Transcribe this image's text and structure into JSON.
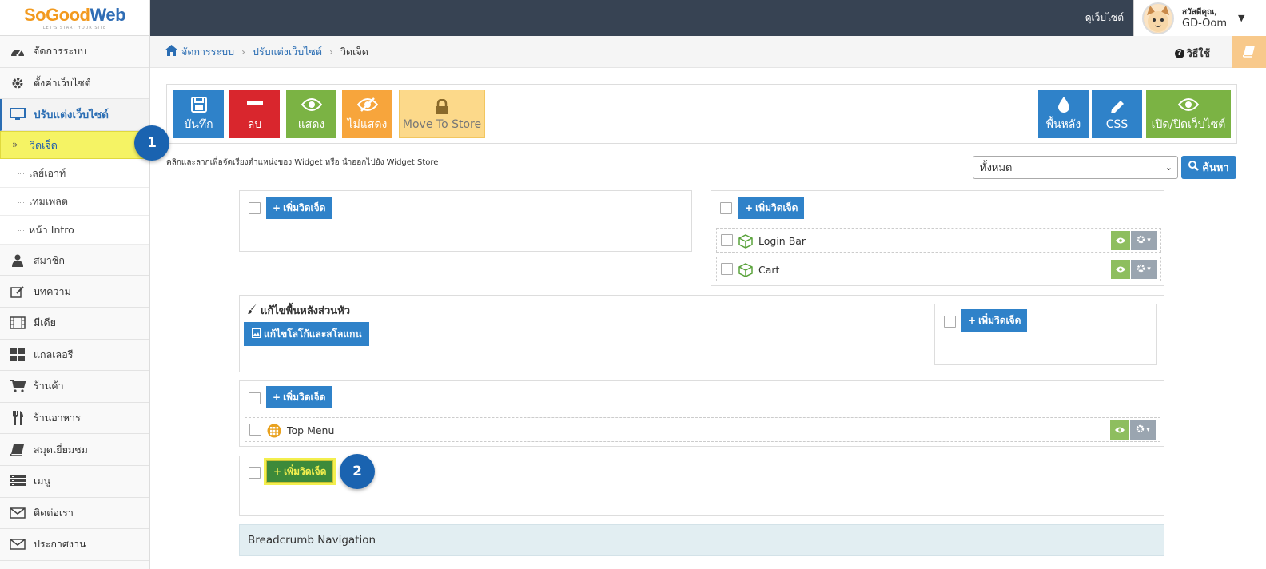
{
  "logo": {
    "so": "So",
    "good": "Good",
    "web": "Web",
    "tagline": "LET'S START YOUR SITE"
  },
  "sidebar": {
    "items": [
      {
        "label": "จัดการระบบ",
        "icon": "dashboard-icon"
      },
      {
        "label": "ตั้งค่าเว็บไซต์",
        "icon": "gear-icon"
      },
      {
        "label": "ปรับแต่งเว็บไซต์",
        "icon": "monitor-icon"
      }
    ],
    "subitems": [
      {
        "label": "วิดเจ็ด"
      },
      {
        "label": "เลย์เอาท์"
      },
      {
        "label": "เทมเพลต"
      },
      {
        "label": "หน้า Intro"
      }
    ],
    "items2": [
      {
        "label": "สมาชิก",
        "icon": "user-icon"
      },
      {
        "label": "บทความ",
        "icon": "edit-icon"
      },
      {
        "label": "มีเดีย",
        "icon": "film-icon"
      },
      {
        "label": "แกลเลอรี",
        "icon": "grid-icon"
      },
      {
        "label": "ร้านค้า",
        "icon": "cart-icon"
      },
      {
        "label": "ร้านอาหาร",
        "icon": "utensils-icon"
      },
      {
        "label": "สมุดเยี่ยมชม",
        "icon": "book-icon"
      },
      {
        "label": "เมนู",
        "icon": "list-icon"
      },
      {
        "label": "ติดต่อเรา",
        "icon": "mail-icon"
      },
      {
        "label": "ประกาศงาน",
        "icon": "mail-icon"
      }
    ]
  },
  "topbar": {
    "visit_site": "ดูเว็บไซต์",
    "greeting": "สวัสดีคุณ,",
    "username": "GD-Oom"
  },
  "breadcrumb": {
    "home": "จัดการระบบ",
    "level2": "ปรับแต่งเว็บไซต์",
    "current": "วิดเจ็ด",
    "howto": "วิธีใช้"
  },
  "toolbar": {
    "save": "บันทึก",
    "delete": "ลบ",
    "show": "แสดง",
    "hide": "ไม่แสดง",
    "store": "Move To Store",
    "background": "พื้นหลัง",
    "css": "CSS",
    "toggle_site": "เปิด/ปิดเว็บไซต์"
  },
  "hint": "คลิกและลากเพื่อจัดเรียงตำแหน่งของ Widget หรือ นำออกไปยัง Widget Store",
  "filter": {
    "selected": "ทั้งหมด",
    "search": "ค้นหา"
  },
  "add_widget": "เพิ่มวิดเจ็ด",
  "widgets": {
    "login_bar": "Login Bar",
    "cart": "Cart",
    "top_menu": "Top Menu"
  },
  "header_panel": {
    "title": "แก้ไขพื้นหลังส่วนหัว",
    "edit_logo": "แก้ไขโลโก้และสโลแกน"
  },
  "breadcrumb_nav": "Breadcrumb Navigation",
  "badges": {
    "one": "1",
    "two": "2"
  },
  "colors": {
    "primary": "#2f82c9",
    "danger": "#d9262d",
    "success": "#7bb344",
    "warning": "#f7a53c",
    "topbar": "#374353",
    "highlight": "#f5f364"
  }
}
